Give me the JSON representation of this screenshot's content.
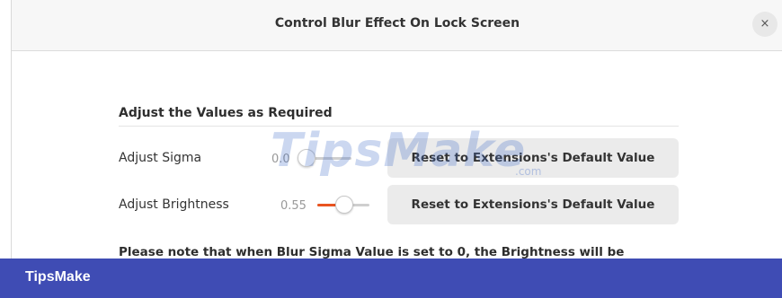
{
  "window": {
    "title": "Control Blur Effect On Lock Screen",
    "close_glyph": "×"
  },
  "section": {
    "title": "Adjust the Values as Required"
  },
  "rows": [
    {
      "label": "Adjust Sigma",
      "value": "0.0",
      "slider_fraction": 0.0,
      "reset_label": "Reset to Extensions's Default Value"
    },
    {
      "label": "Adjust Brightness",
      "value": "0.55",
      "slider_fraction": 0.55,
      "reset_label": "Reset to Extensions's Default Value"
    }
  ],
  "note": "Please note that when Blur Sigma Value is set to 0, the Brightness will be",
  "watermark": {
    "text": "TipsMake",
    "suffix": ".com"
  },
  "footer": {
    "brand": "TipsMake"
  },
  "colors": {
    "accent": "#e95420",
    "footer_bg": "#3f4cb4"
  }
}
